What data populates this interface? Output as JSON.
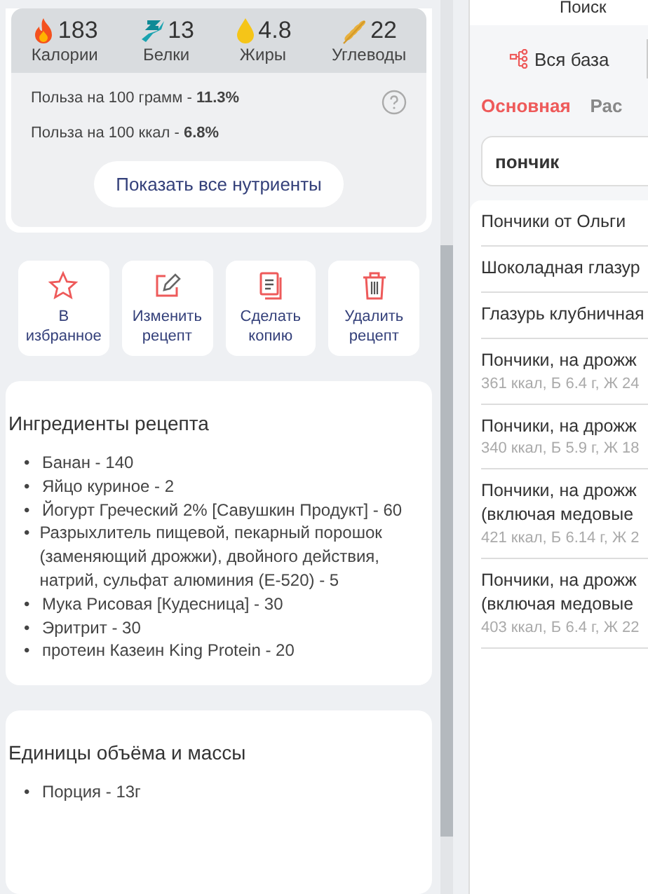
{
  "macros": [
    {
      "kind": "calories",
      "value": "183",
      "label": "Калории"
    },
    {
      "kind": "protein",
      "value": "13",
      "label": "Белки"
    },
    {
      "kind": "fat",
      "value": "4.8",
      "label": "Жиры"
    },
    {
      "kind": "carbs",
      "value": "22",
      "label": "Углеводы"
    }
  ],
  "benefit": [
    "Польза на 100 грамм - **11.3%**",
    "Польза на 100 ккал - **6.8%**"
  ],
  "show_all_button": "Показать все нутриенты",
  "actions": [
    {
      "kind": "favorite",
      "lines": [
        "В",
        "избранное"
      ]
    },
    {
      "kind": "edit",
      "lines": [
        "Изменить",
        "рецепт"
      ]
    },
    {
      "kind": "copy",
      "lines": [
        "Сделать",
        "копию"
      ]
    },
    {
      "kind": "delete",
      "lines": [
        "Удалить",
        "рецепт"
      ]
    }
  ],
  "ingredients": {
    "title": "Ингредиенты рецепта",
    "bullet": "•",
    "items": [
      "Банан - 140",
      "Яйцо куриное - 2",
      "Йогурт Греческий 2% [Савушкин Продукт] - 60",
      "Разрыхлитель пищевой, пекарный порошок (заменяющий дрожжи), двойного действия, натрий, сульфат алюминия (Е-520) - 5",
      "Мука Рисовая [Кудесница] - 30",
      "Эритрит - 30",
      "протеин Казеин King Protein - 20"
    ]
  },
  "units": {
    "title": "Единицы объёма и массы",
    "bullet": "•",
    "items": [
      "Порция - 13г"
    ]
  },
  "search_panel": {
    "title": "Поиск",
    "source_tab": "Вся база",
    "tabs": [
      {
        "label": "Основная",
        "selected": true
      },
      {
        "label": "Рас",
        "selected": false
      }
    ],
    "query": "пончик",
    "results": [
      {
        "name": [
          "Пончики от Ольги"
        ]
      },
      {
        "name": [
          "Шоколадная глазур"
        ]
      },
      {
        "name": [
          "Глазурь клубничная"
        ]
      },
      {
        "name": [
          "Пончики, на дрожж"
        ],
        "details": "361 ккал, Б 6.4 г, Ж 24"
      },
      {
        "name": [
          "Пончики, на дрожж"
        ],
        "details": "340 ккал, Б 5.9 г, Ж 18"
      },
      {
        "name": [
          "Пончики, на дрожж",
          "(включая медовые"
        ],
        "details": "421 ккал, Б 6.14 г, Ж 2"
      },
      {
        "name": [
          "Пончики, на дрожж",
          "(включая медовые"
        ],
        "details": "403 ккал, Б 6.4 г, Ж 22"
      }
    ]
  }
}
